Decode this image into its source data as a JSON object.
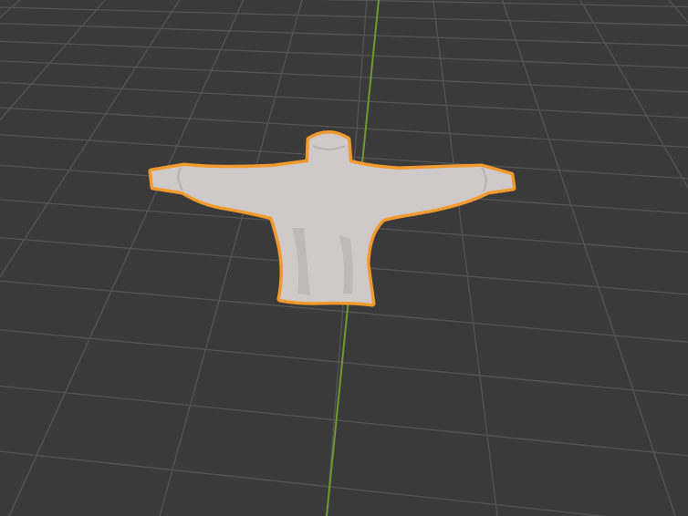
{
  "viewport": {
    "background_color": "#3a3a3a",
    "grid_line_color": "#555555",
    "y_axis_color": "#6f9a2a",
    "x_axis_visible": false,
    "y_axis_visible": true
  },
  "scene": {
    "selected_object": {
      "kind": "sweater-mesh",
      "selected": true,
      "outline_color": "#f29a2e",
      "fabric_color": "#cfc9c9",
      "fabric_shadow_color": "#a9a3a3"
    }
  }
}
